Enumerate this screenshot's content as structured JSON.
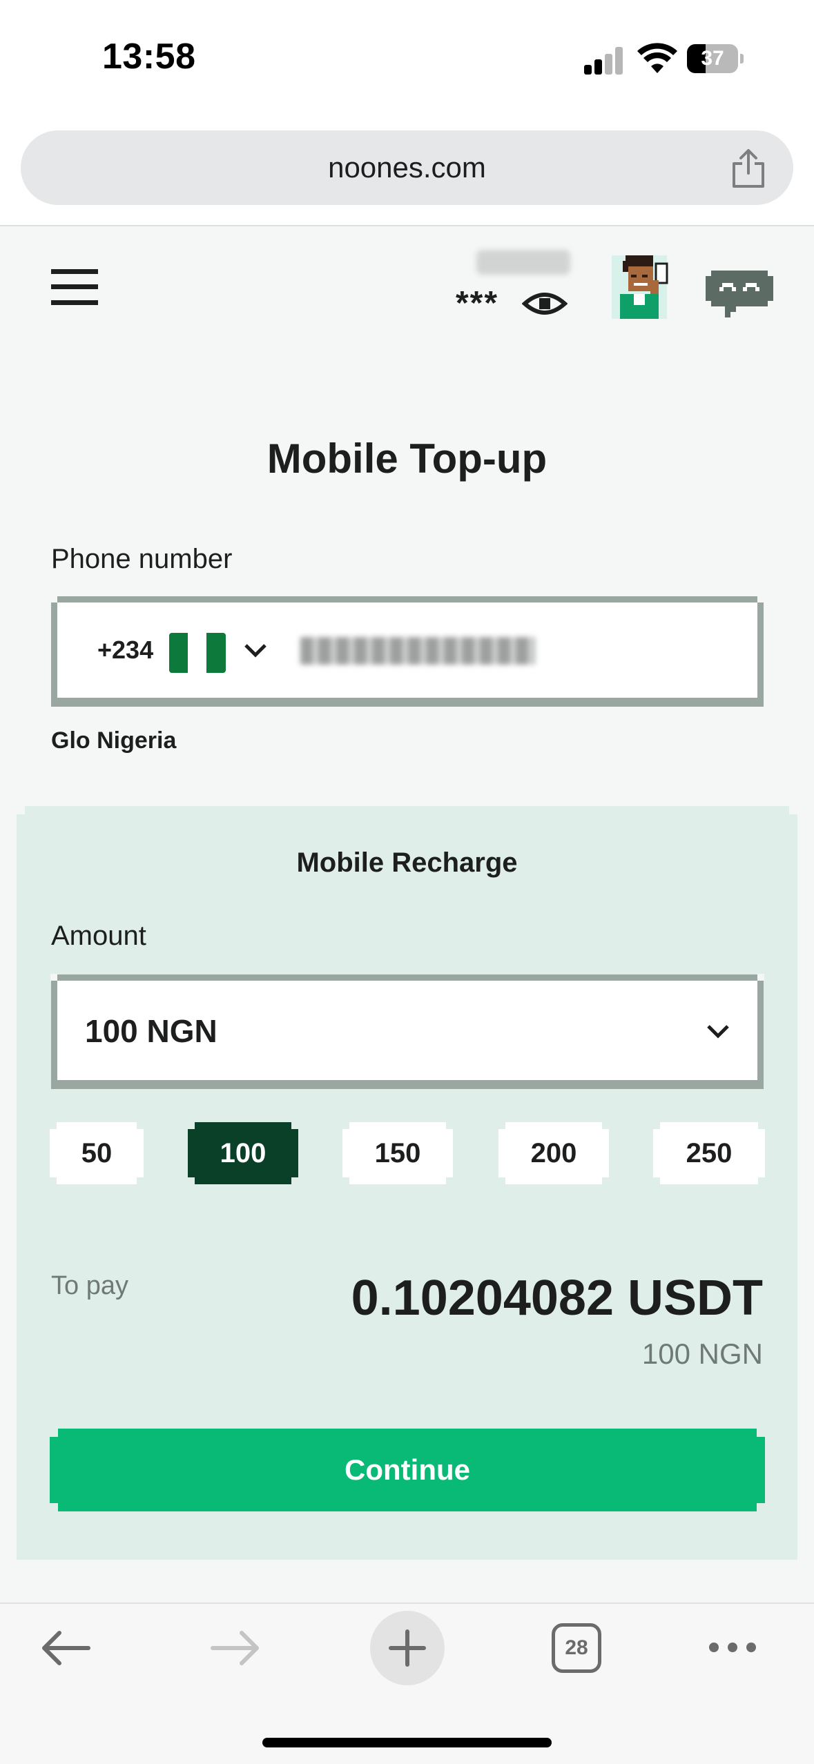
{
  "status_bar": {
    "time": "13:58",
    "battery_level": "37",
    "battery_fraction": 0.37
  },
  "browser": {
    "url": "noones.com",
    "open_tabs_count": "28"
  },
  "header": {
    "balance_mask": "***"
  },
  "page": {
    "title": "Mobile Top-up"
  },
  "phone": {
    "label": "Phone number",
    "dial_code": "+234",
    "country_flag": "nigeria-flag",
    "carrier": "Glo Nigeria"
  },
  "recharge": {
    "title": "Mobile Recharge",
    "amount_label": "Amount",
    "selected_amount": "100 NGN",
    "quick_amounts": [
      "50",
      "100",
      "150",
      "200",
      "250"
    ],
    "selected_quick_amount": "100",
    "to_pay_label": "To pay",
    "to_pay_value": "0.10204082 USDT",
    "to_pay_local": "100 NGN",
    "continue_label": "Continue"
  },
  "colors": {
    "brand_green": "#09b976",
    "dark_green": "#0b4028",
    "panel_bg": "#e0eeea",
    "page_bg": "#f5f7f6"
  },
  "icons": {
    "menu": "hamburger-menu-icon",
    "visibility": "eye-icon",
    "chat": "chat-bubble-icon",
    "share": "share-icon",
    "dropdown": "chevron-down-icon"
  }
}
